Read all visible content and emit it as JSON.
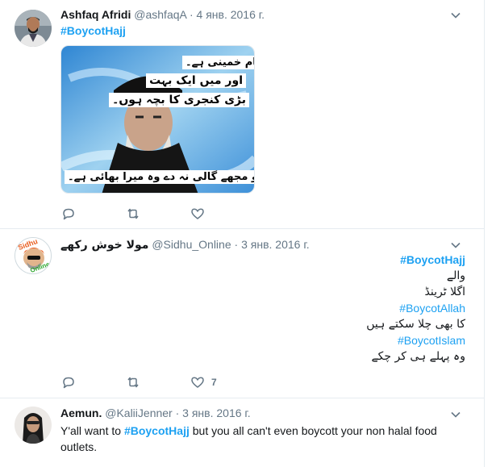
{
  "tweets": [
    {
      "name": "Ashfaq Afridi",
      "handle": "@ashfaqA",
      "separator": "·",
      "date": "4 янв. 2016 г.",
      "hashtag": "#BoycotHajj",
      "image_text": {
        "line1": "میرا نام خمینی ہے۔",
        "line2": "اور میں ایک بہت",
        "line3": "بڑی کنجری کا بچہ ہوں۔",
        "line4": "جو مجھے گالی نہ دے وہ میرا بھائی ہے۔"
      },
      "likes": ""
    },
    {
      "name": "مولا خوش رکھے",
      "handle": "@Sidhu_Online",
      "separator": "·",
      "date": "3 янв. 2016 г.",
      "avatar_text": {
        "top": "Sidhu",
        "bottom": "Online"
      },
      "lines": [
        {
          "text": "#BoycotHajj",
          "kind": "hashtag"
        },
        {
          "text": "والے",
          "kind": "urdu"
        },
        {
          "text": "اگلا ٹرینڈ",
          "kind": "urdu"
        },
        {
          "text": "#BoycotAllah",
          "kind": "hashtag-light"
        },
        {
          "text": "کا بھی چلا سکتے ہیں",
          "kind": "urdu"
        },
        {
          "text": "#BoycotIslam",
          "kind": "hashtag-light"
        },
        {
          "text": "وہ پہلے ہی کر چکے",
          "kind": "urdu"
        }
      ],
      "likes": "7"
    },
    {
      "name": "Aemun.",
      "handle": "@KaliiJenner",
      "separator": "·",
      "date": "3 янв. 2016 г.",
      "text_before": "Y'all want to ",
      "hashtag": "#BoycotHajj",
      "text_after": " but you all can't even boycott your non halal food outlets."
    }
  ],
  "icons": {
    "reply": "reply-icon",
    "retweet": "retweet-icon",
    "like": "heart-icon",
    "more": "chevron-down-icon"
  },
  "colors": {
    "accent": "#1da1f2",
    "secondary_text": "#657786",
    "border": "#e6ecf0"
  }
}
